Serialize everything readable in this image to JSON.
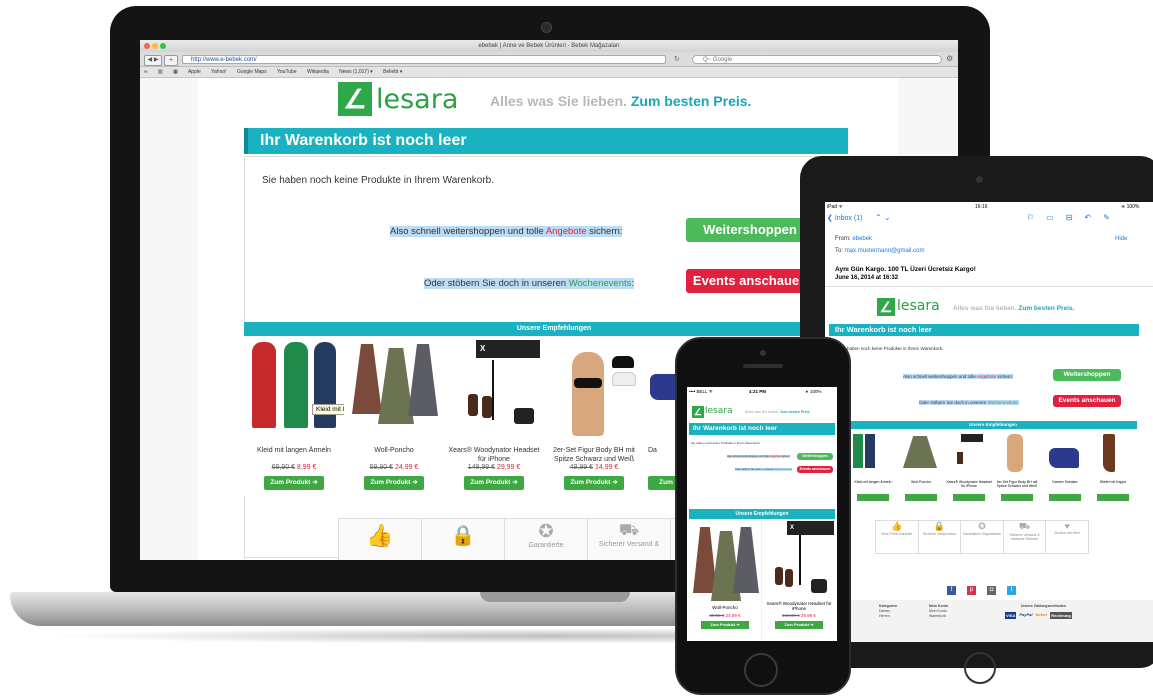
{
  "browser": {
    "title": "ebebek | Anne ve Bebek Ürünleri - Bebek Mağazaları",
    "url": "http://www.e-bebek.com/",
    "search_placeholder": "Q~ Google",
    "bookmarks": [
      "Apple",
      "Yahoo!",
      "Google Maps",
      "YouTube",
      "Wikipedia",
      "News (1,017) ▾",
      "Beliebt ▾"
    ]
  },
  "site": {
    "logo_text": "lesara",
    "tagline_gray": "Alles was Sie lieben.",
    "tagline_blue": "Zum besten Preis."
  },
  "cart": {
    "header": "Ihr Warenkorb ist noch leer",
    "empty_text": "Sie haben noch keine Produkte in Ihrem Warenkorb.",
    "shop_prefix": "Also schnell weitershoppen und tolle",
    "shop_highlight": "Angebote",
    "shop_suffix": "sichern:",
    "shop_button": "Weitershoppen",
    "events_prefix": "Oder stöbern Sie doch in unseren",
    "events_highlight": "Wochenevents",
    "events_suffix": ":",
    "events_button": "Events anschauen"
  },
  "recommendations": {
    "header": "Unsere Empfehlungen",
    "tooltip": "Kleid mit langen Ärmeln",
    "products": [
      {
        "name": "Kleid mit langen Ärmeln",
        "old": "69,90 €",
        "new": "8,99 €",
        "button": "Zum Produkt"
      },
      {
        "name": "Woll-Poncho",
        "old": "69,90 €",
        "new": "24,99 €",
        "button": "Zum Produkt"
      },
      {
        "name": "Xears® Woodynator Headset für iPhone",
        "old": "149,99 €",
        "new": "29,99 €",
        "button": "Zum Produkt"
      },
      {
        "name": "2er-Set Figur Body BH mit Spitze Schwarz und Weiß",
        "old": "49,99 €",
        "new": "14,99 €",
        "button": "Zum Produkt"
      },
      {
        "name": "Da",
        "old": "",
        "new": "",
        "button": "Zum"
      }
    ]
  },
  "trust": {
    "items": [
      "",
      "",
      "Garantierte",
      "Sicherer Versand &"
    ]
  },
  "tablet": {
    "status_left": "iPad ᯤ",
    "status_time": "16:16",
    "status_right": "∗ 100%",
    "inbox": "Inbox (1)",
    "from_label": "From:",
    "from_value": "ebebek",
    "to_label": "To:",
    "to_value": "max.mustermann@gmail.com",
    "hide": "Hide",
    "subject": "Aynı Gün Kargo. 100 TL Üzeri Ücretsiz Kargo!",
    "date": "June 16, 2014 at 16:32",
    "cart_intro": "haben noch keine Produkte in Ihrem Warenkorb.",
    "product_names": [
      "Kleid mit langen Ärmeln",
      "Woll-Poncho",
      "Xears® Woodynator Headset für iPhone",
      "2er-Set Figur Body BH mit Spitze Schwarz und Weiß",
      "Damen Sneaker",
      "Stiefel mit Kappe"
    ],
    "trust_items": [
      "Best-Preis-Garantie",
      "Sicherer Zahlprozess",
      "Garantierte Originalware",
      "Sicherer Versand & einfache Retoure",
      "Service mit Herz"
    ],
    "footer": {
      "col1": [
        "Kategorien",
        "Damen",
        "Herren"
      ],
      "col2": [
        "Mein Konto",
        "Mein Konto",
        "Warenkorb"
      ],
      "payments_title": "Unsere Zahlungsmethoden",
      "payments": [
        "VISA",
        "PayPal",
        "Sofort",
        "Rechnung"
      ]
    }
  },
  "phone": {
    "carrier": "•••• BELL ᯤ",
    "time": "4:21 PM",
    "battery": "∗ 100%",
    "products": [
      {
        "name": "Woll-Poncho",
        "old": "69,90 €",
        "new": "24,99 €",
        "button": "Zum Produkt"
      },
      {
        "name": "Xears® Woodynator Headset für iPhone",
        "old": "149,99 €",
        "new": "29,99 €",
        "button": "Zum Produkt"
      }
    ]
  },
  "colors": {
    "teal": "#1ab2c1",
    "green": "#4cba5b",
    "red": "#e0223e",
    "logo_green": "#2aa243"
  }
}
